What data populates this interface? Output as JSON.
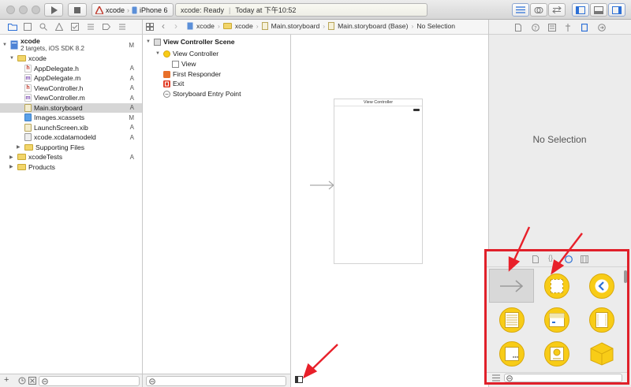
{
  "toolbar": {
    "scheme_target": "xcode",
    "scheme_device": "iPhone 6",
    "status_label": "xcode: Ready",
    "status_time": "Today at 下午10:52"
  },
  "jumpbar": {
    "items": [
      "xcode",
      "xcode",
      "Main.storyboard",
      "Main.storyboard (Base)",
      "No Selection"
    ]
  },
  "navigator": {
    "project_name": "xcode",
    "project_subtitle": "2 targets, iOS SDK 8.2",
    "project_badge": "M",
    "items": [
      {
        "label": "xcode",
        "badge": "",
        "kind": "folder"
      },
      {
        "label": "AppDelegate.h",
        "badge": "A",
        "kind": "h"
      },
      {
        "label": "AppDelegate.m",
        "badge": "A",
        "kind": "m"
      },
      {
        "label": "ViewController.h",
        "badge": "A",
        "kind": "h"
      },
      {
        "label": "ViewController.m",
        "badge": "A",
        "kind": "m"
      },
      {
        "label": "Main.storyboard",
        "badge": "A",
        "kind": "sb"
      },
      {
        "label": "Images.xcassets",
        "badge": "M",
        "kind": "assets"
      },
      {
        "label": "LaunchScreen.xib",
        "badge": "A",
        "kind": "xib"
      },
      {
        "label": "xcode.xcdatamodeld",
        "badge": "A",
        "kind": "model"
      },
      {
        "label": "Supporting Files",
        "badge": "",
        "kind": "folder"
      },
      {
        "label": "xcodeTests",
        "badge": "A",
        "kind": "folder"
      },
      {
        "label": "Products",
        "badge": "",
        "kind": "folder"
      }
    ]
  },
  "outline": {
    "scene": "View Controller Scene",
    "view_controller": "View Controller",
    "view": "View",
    "first_responder": "First Responder",
    "exit": "Exit",
    "entry_point": "Storyboard Entry Point"
  },
  "canvas": {
    "vc_title": "View Controller"
  },
  "inspector": {
    "no_selection": "No Selection"
  },
  "colors": {
    "highlight": "#e0202a",
    "library_icon": "#f8cc17",
    "selection": "#d6d6d6"
  }
}
